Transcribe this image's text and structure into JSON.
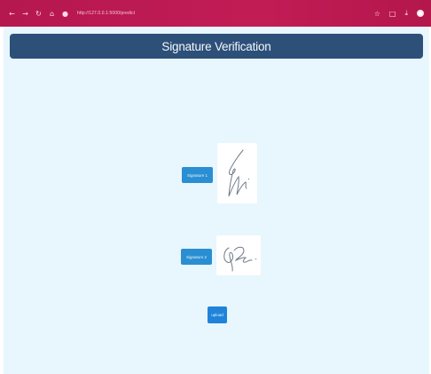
{
  "browser": {
    "url": "http://127.0.0.1:5000/predict",
    "back_icon": "back-arrow-icon",
    "forward_icon": "forward-arrow-icon",
    "reload_icon": "reload-icon",
    "lock_icon": "lock-icon",
    "star_icon": "star-icon",
    "extensions_icon": "extensions-icon",
    "download_icon": "download-icon",
    "profile_icon": "profile-icon",
    "bar_color": "#c21c55"
  },
  "header": {
    "title": "Signature Verification",
    "color": "#2d5079"
  },
  "signatures": [
    {
      "label": "Signature 1"
    },
    {
      "label": "Signature 2"
    }
  ],
  "submit": {
    "label": "upload"
  },
  "colors": {
    "page_background": "#e8f6fd",
    "button": "#2a8ed2"
  }
}
